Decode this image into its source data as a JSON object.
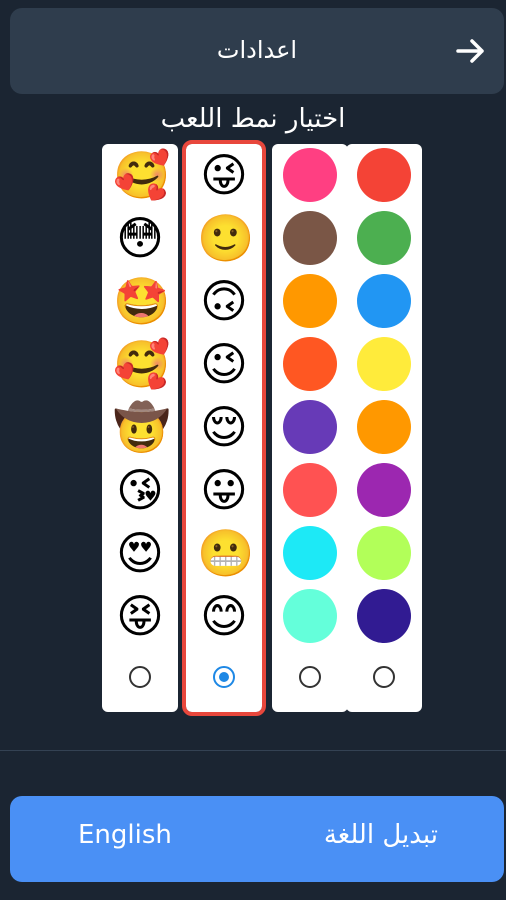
{
  "header": {
    "title": "اعدادات",
    "back_icon": "arrow-right-icon"
  },
  "section_title": "اختيار نمط اللعب",
  "styles": [
    {
      "kind": "emoji",
      "selected": false,
      "items": [
        "🥰",
        "😳",
        "🤩",
        "🥰",
        "🤠",
        "😘",
        "😍",
        "😝"
      ]
    },
    {
      "kind": "emoji",
      "selected": true,
      "items": [
        "😜",
        "🙂",
        "🙃",
        "😉",
        "😌",
        "😛",
        "😬",
        "😊"
      ]
    },
    {
      "kind": "color",
      "selected": false,
      "items": [
        "#ff3f82",
        "#7a5646",
        "#ff9800",
        "#ff5722",
        "#673ab7",
        "#ff5252",
        "#1de9f6",
        "#64ffda"
      ]
    },
    {
      "kind": "color",
      "selected": false,
      "items": [
        "#f44336",
        "#4caf50",
        "#2196f3",
        "#ffeb3b",
        "#ff9800",
        "#9c27b0",
        "#b2ff59",
        "#311b92"
      ]
    }
  ],
  "language": {
    "english_label": "English",
    "switch_label": "تبديل اللغة"
  },
  "colors": {
    "background": "#1b2532",
    "header_bg": "#2f3d4d",
    "selected_outline": "#e8473c",
    "radio_checked": "#1e88e5",
    "language_bar": "#4a90f5"
  }
}
